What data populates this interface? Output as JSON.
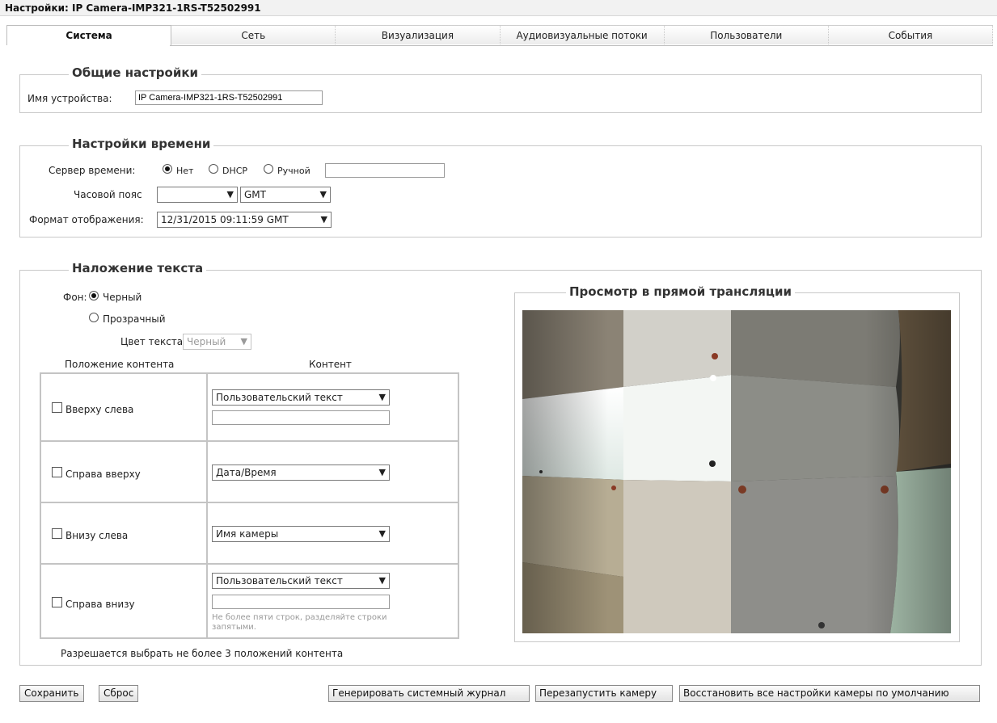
{
  "title": "Настройки: IP Camera-IMP321-1RS-T52502991",
  "tabs": [
    {
      "label": "Система",
      "active": true
    },
    {
      "label": "Сеть",
      "active": false
    },
    {
      "label": "Визуализация",
      "active": false
    },
    {
      "label": "Аудиовизуальные потоки",
      "active": false
    },
    {
      "label": "Пользователи",
      "active": false
    },
    {
      "label": "События",
      "active": false
    }
  ],
  "general": {
    "legend": "Общие настройки",
    "device_name_label": "Имя устройства:",
    "device_name_value": "IP Camera-IMP321-1RS-T52502991"
  },
  "time": {
    "legend": "Настройки времени",
    "server_label": "Сервер времени:",
    "option_none": "Нет",
    "option_dhcp": "DHCP",
    "option_manual": "Ручной",
    "selected": "Нет",
    "manual_value": "",
    "timezone_label": "Часовой пояс",
    "timezone_value": "",
    "gmt_value": "GMT",
    "format_label": "Формат отображения:",
    "format_value": "12/31/2015 09:11:59 GMT"
  },
  "overlay": {
    "legend": "Наложение текста",
    "background_label": "Фон:",
    "bg_black": "Черный",
    "bg_transparent": "Прозрачный",
    "bg_selected": "Черный",
    "text_color_label": "Цвет текста",
    "text_color_value": "Черный",
    "col_position": "Положение контента",
    "col_content": "Контент",
    "rows": [
      {
        "label": "Вверху слева",
        "checked": false,
        "content": "Пользовательский текст",
        "text": ""
      },
      {
        "label": "Справа вверху",
        "checked": false,
        "content": "Дата/Время"
      },
      {
        "label": "Внизу слева",
        "checked": false,
        "content": "Имя камеры"
      },
      {
        "label": "Справа внизу",
        "checked": false,
        "content": "Пользовательский текст",
        "text": "",
        "hint": "Не более пяти строк, разделяйте строки запятыми."
      }
    ],
    "note": "Разрешается выбрать не более 3 положений контента",
    "preview_legend": "Просмотр в прямой трансляции"
  },
  "buttons": {
    "save": "Сохранить",
    "reset": "Сброс",
    "gen_log": "Генерировать системный журнал",
    "restart": "Перезапустить камеру",
    "restore": "Восстановить все настройки камеры по умолчанию"
  },
  "icons": {
    "dropdown": "chevron-down-icon"
  }
}
